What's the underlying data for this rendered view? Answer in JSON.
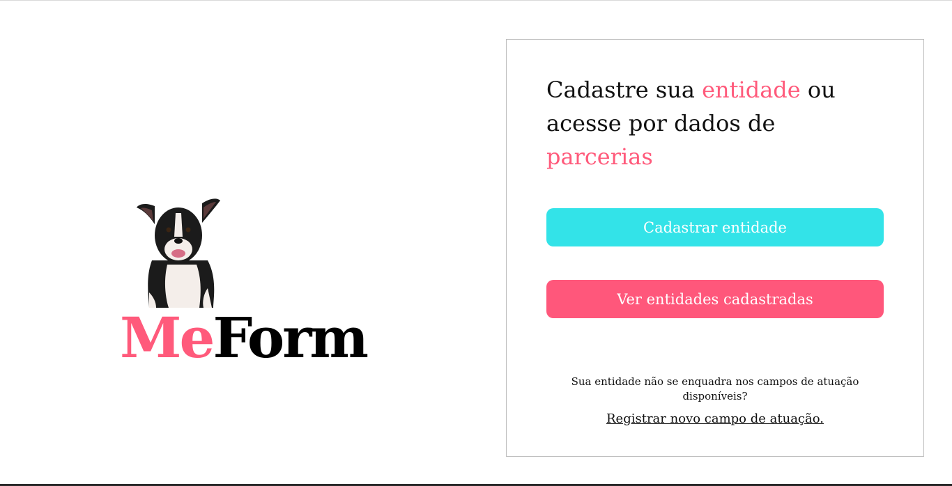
{
  "brand": {
    "logo_prefix": "Me",
    "logo_suffix": "Form",
    "colors": {
      "pink": "#ff5a7b",
      "black": "#000000"
    }
  },
  "card": {
    "headline": {
      "part1": "Cadastre sua ",
      "accent1": "entidade",
      "part2": " ou acesse por dados de ",
      "accent2": "parcerias"
    },
    "register_button_label": "Cadastrar entidade",
    "view_button_label": "Ver entidades cadastradas",
    "note": "Sua entidade não se enquadra nos campos de atuação disponíveis?",
    "register_field_link": "Registrar novo campo de atuação."
  },
  "colors": {
    "accent_pink": "#ff577b",
    "accent_cyan": "#33e3e8",
    "card_border": "#bdbdbd"
  }
}
